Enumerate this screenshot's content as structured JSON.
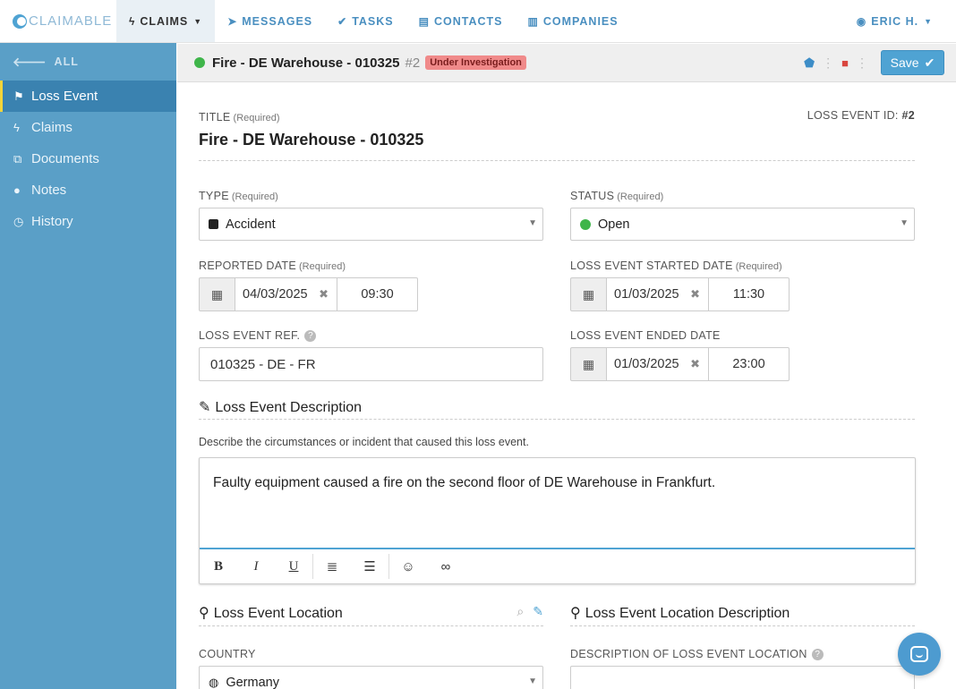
{
  "brand": {
    "name": "CLAIMABLE"
  },
  "topnav": {
    "items": [
      {
        "label": "CLAIMS",
        "icon": "bolt-icon"
      },
      {
        "label": "MESSAGES",
        "icon": "send-icon"
      },
      {
        "label": "TASKS",
        "icon": "check-icon"
      },
      {
        "label": "CONTACTS",
        "icon": "contact-card-icon"
      },
      {
        "label": "COMPANIES",
        "icon": "building-icon"
      }
    ],
    "user": "ERIC H."
  },
  "sidebar": {
    "back_label": "ALL",
    "items": [
      {
        "label": "Loss Event",
        "icon": "flag-icon"
      },
      {
        "label": "Claims",
        "icon": "bolt-icon"
      },
      {
        "label": "Documents",
        "icon": "copy-icon"
      },
      {
        "label": "Notes",
        "icon": "comment-icon"
      },
      {
        "label": "History",
        "icon": "clock-icon"
      }
    ]
  },
  "subheader": {
    "title": "Fire - DE Warehouse - 010325",
    "number": "#2",
    "status_badge": "Under Investigation",
    "save_label": "Save"
  },
  "form": {
    "title_label": "TITLE",
    "required": "(Required)",
    "title_value": "Fire - DE Warehouse - 010325",
    "id_label": "LOSS EVENT ID:",
    "id_value": "#2",
    "type_label": "TYPE",
    "type_value": "Accident",
    "status_label": "STATUS",
    "status_value": "Open",
    "reported_label": "REPORTED DATE",
    "reported_date": "04/03/2025",
    "reported_time": "09:30",
    "started_label": "LOSS EVENT STARTED DATE",
    "started_date": "01/03/2025",
    "started_time": "11:30",
    "ref_label": "LOSS EVENT REF.",
    "ref_value": "010325 - DE - FR",
    "ended_label": "LOSS EVENT ENDED DATE",
    "ended_date": "01/03/2025",
    "ended_time": "23:00",
    "description_heading": "Loss Event Description",
    "description_help": "Describe the circumstances or incident that caused this loss event.",
    "description_value": "Faulty equipment caused a fire on the second floor of DE Warehouse in Frankfurt.",
    "location_heading": "Loss Event Location",
    "location_desc_heading": "Loss Event Location Description",
    "country_label": "COUNTRY",
    "country_value": "Germany",
    "location_desc_label": "DESCRIPTION OF LOSS EVENT LOCATION"
  },
  "colors": {
    "accent": "#4fa3d3",
    "sidebar": "#5a9fc7",
    "sidebar_active": "#3a82b0",
    "status_open": "#3fb54a",
    "badge": "#f08a8a"
  }
}
